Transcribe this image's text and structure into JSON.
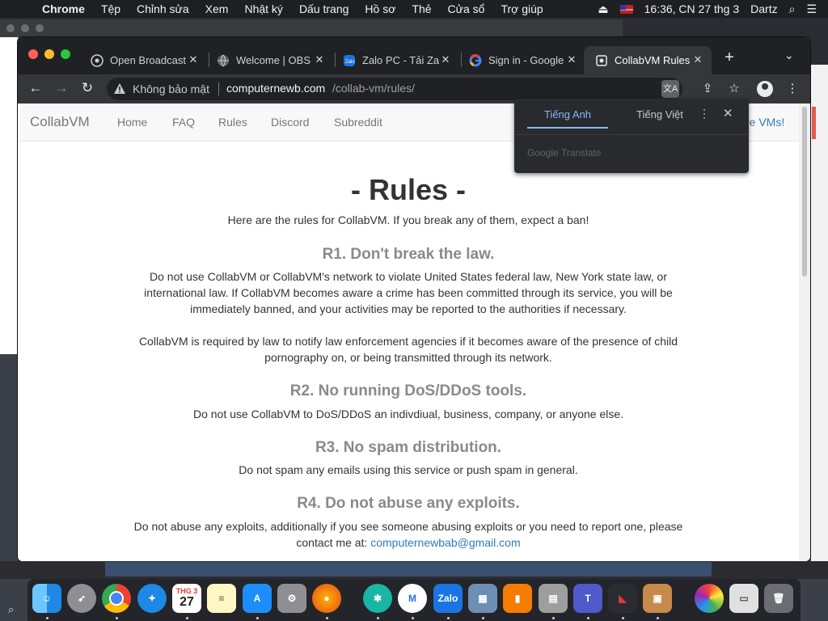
{
  "menubar": {
    "app_name": "Chrome",
    "items": [
      "Tệp",
      "Chỉnh sửa",
      "Xem",
      "Nhật ký",
      "Dấu trang",
      "Hồ sơ",
      "Thẻ",
      "Cửa sổ",
      "Trợ giúp"
    ],
    "clock": "16:36, CN 27 thg 3",
    "user": "Dartz"
  },
  "tabs": [
    {
      "label": "Open Broadcast",
      "icon": "obs-icon"
    },
    {
      "label": "Welcome | OBS",
      "icon": "globe-icon"
    },
    {
      "label": "Zalo PC - Tải Za",
      "icon": "zalo-icon"
    },
    {
      "label": "Sign in - Google",
      "icon": "google-icon"
    },
    {
      "label": "CollabVM Rules",
      "icon": "collabvm-icon"
    }
  ],
  "omnibox": {
    "security_label": "Không bảo mật",
    "url_host": "computernewb.com",
    "url_path": "/collab-vm/rules/"
  },
  "translate_popup": {
    "tab_source": "Tiếng Anh",
    "tab_target": "Tiếng Việt",
    "footer": "Google Translate"
  },
  "site": {
    "brand": "CollabVM",
    "nav": [
      "Home",
      "FAQ",
      "Rules",
      "Discord",
      "Subreddit"
    ],
    "nav_right": "re VMs!"
  },
  "rules_page": {
    "title": "- Rules -",
    "intro": "Here are the rules for CollabVM. If you break any of them, expect a ban!",
    "r1_heading": "R1. Don't break the law.",
    "r1_p1": "Do not use CollabVM or CollabVM's network to violate United States federal law, New York state law, or international law. If CollabVM becomes aware a crime has been committed through its service, you will be immediately banned, and your activities may be reported to the authorities if necessary.",
    "r1_p2": "CollabVM is required by law to notify law enforcement agencies if it becomes aware of the presence of child pornography on, or being transmitted through its network.",
    "r2_heading": "R2. No running DoS/DDoS tools.",
    "r2_p": "Do not use CollabVM to DoS/DDoS an indivdiual, business, company, or anyone else.",
    "r3_heading": "R3. No spam distribution.",
    "r3_p": "Do not spam any emails using this service or push spam in general.",
    "r4_heading": "R4. Do not abuse any exploits.",
    "r4_p": "Do not abuse any exploits, additionally if you see someone abusing exploits or you need to report one, please contact me at:",
    "r4_email": "computernewbab@gmail.com"
  },
  "dock_apps": [
    "Finder",
    "Launchpad",
    "Chrome",
    "Safari",
    "Calendar",
    "Notes",
    "App Store",
    "System Preferences",
    "Firefox",
    "Bitwarden",
    "Messenger",
    "Zalo",
    "Archiver",
    "Books",
    "Utility",
    "Teams",
    "Hotspot",
    "Box",
    "Photos",
    "Preview",
    "Trash"
  ],
  "calendar": {
    "month": "THG 3",
    "day": "27"
  },
  "colors": {
    "link": "#337ab7",
    "heading_gray": "#8a8a8a",
    "chrome_dark": "#202124",
    "chrome_toolbar": "#35363a"
  }
}
